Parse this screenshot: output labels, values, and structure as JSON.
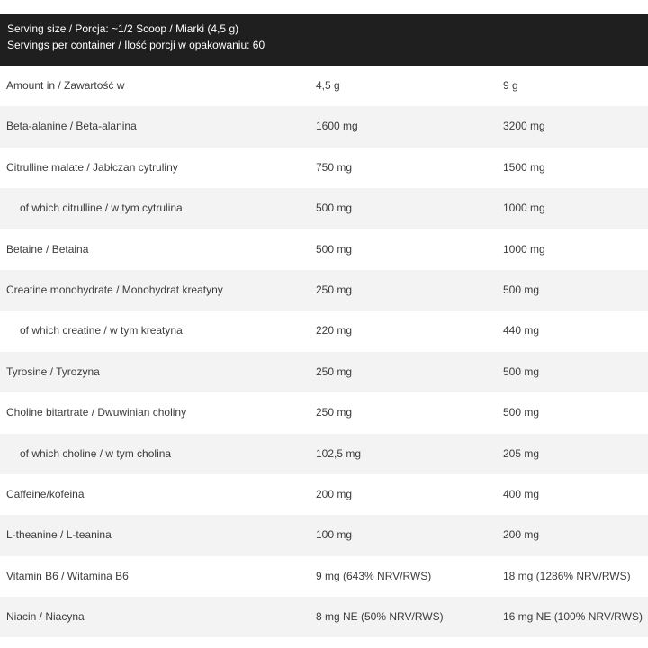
{
  "header": {
    "serving_size": "Serving size / Porcja: ~1/2 Scoop / Miarki (4,5 g)",
    "servings_per_container": "Servings per container / Ilość porcji w opakowaniu: 60"
  },
  "rows": [
    {
      "label": "Amount in / Zawartość w",
      "v1": "4,5 g",
      "v2": "9 g",
      "indent": false
    },
    {
      "label": "Beta-alanine / Beta-alanina",
      "v1": "1600 mg",
      "v2": "3200 mg",
      "indent": false
    },
    {
      "label": "Citrulline malate / Jabłczan cytruliny",
      "v1": "750 mg",
      "v2": "1500 mg",
      "indent": false
    },
    {
      "label": "of which citrulline / w tym cytrulina",
      "v1": "500 mg",
      "v2": "1000 mg",
      "indent": true
    },
    {
      "label": "Betaine / Betaina",
      "v1": "500 mg",
      "v2": "1000 mg",
      "indent": false
    },
    {
      "label": "Creatine monohydrate / Monohydrat kreatyny",
      "v1": "250 mg",
      "v2": "500 mg",
      "indent": false
    },
    {
      "label": "of which creatine / w tym kreatyna",
      "v1": "220 mg",
      "v2": "440 mg",
      "indent": true
    },
    {
      "label": "Tyrosine / Tyrozyna",
      "v1": "250 mg",
      "v2": "500 mg",
      "indent": false
    },
    {
      "label": "Choline bitartrate / Dwuwinian choliny",
      "v1": "250 mg",
      "v2": "500 mg",
      "indent": false
    },
    {
      "label": "of which choline / w  tym cholina",
      "v1": "102,5 mg",
      "v2": "205 mg",
      "indent": true
    },
    {
      "label": "Caffeine/kofeina",
      "v1": "200 mg",
      "v2": "400 mg",
      "indent": false
    },
    {
      "label": "L-theanine / L-teanina",
      "v1": "100 mg",
      "v2": "200 mg",
      "indent": false
    },
    {
      "label": "Vitamin B6 / Witamina B6",
      "v1": "9 mg (643% NRV/RWS)",
      "v2": "18 mg (1286% NRV/RWS)",
      "indent": false
    },
    {
      "label": "Niacin / Niacyna",
      "v1": "8 mg NE (50% NRV/RWS)",
      "v2": "16 mg NE (100% NRV/RWS)",
      "indent": false
    }
  ]
}
